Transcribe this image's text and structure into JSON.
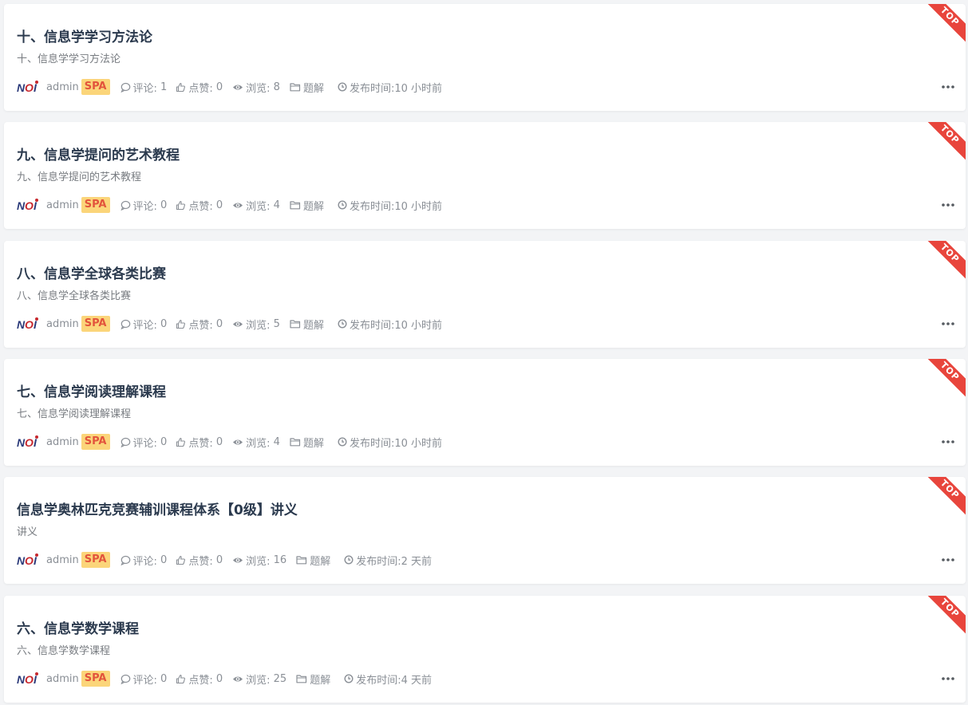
{
  "labels": {
    "comment": "评论:",
    "like": "点赞:",
    "view": "浏览:",
    "published": "发布时间:",
    "category": "题解",
    "top_badge": "TOP",
    "author": "admin",
    "author_badge": "SPA"
  },
  "colors": {
    "title": "#2b3a4e",
    "meta": "#8a8f96",
    "badge_bg": "#fbd57a",
    "badge_text": "#e2533c",
    "ribbon": "#e8453c"
  },
  "icons": {
    "logo": "noi-logo",
    "comment": "comment-bubble-icon",
    "like": "thumbs-up-icon",
    "view": "eye-icon",
    "category": "folder-icon",
    "time": "clock-icon",
    "more": "more-dots-icon"
  },
  "posts": [
    {
      "title": "十、信息学学习方法论",
      "summary": "十、信息学学习方法论",
      "comments": "1",
      "likes": "0",
      "views": "8",
      "time": "10 小时前"
    },
    {
      "title": "九、信息学提问的艺术教程",
      "summary": "九、信息学提问的艺术教程",
      "comments": "0",
      "likes": "0",
      "views": "4",
      "time": "10 小时前"
    },
    {
      "title": "八、信息学全球各类比赛",
      "summary": "八、信息学全球各类比赛",
      "comments": "0",
      "likes": "0",
      "views": "5",
      "time": "10 小时前"
    },
    {
      "title": "七、信息学阅读理解课程",
      "summary": "七、信息学阅读理解课程",
      "comments": "0",
      "likes": "0",
      "views": "4",
      "time": "10 小时前"
    },
    {
      "title": "信息学奥林匹克竞赛辅训课程体系【0级】讲义",
      "summary": "讲义",
      "comments": "0",
      "likes": "0",
      "views": "16",
      "time": "2 天前"
    },
    {
      "title": "六、信息学数学课程",
      "summary": "六、信息学数学课程",
      "comments": "0",
      "likes": "0",
      "views": "25",
      "time": "4 天前"
    }
  ]
}
